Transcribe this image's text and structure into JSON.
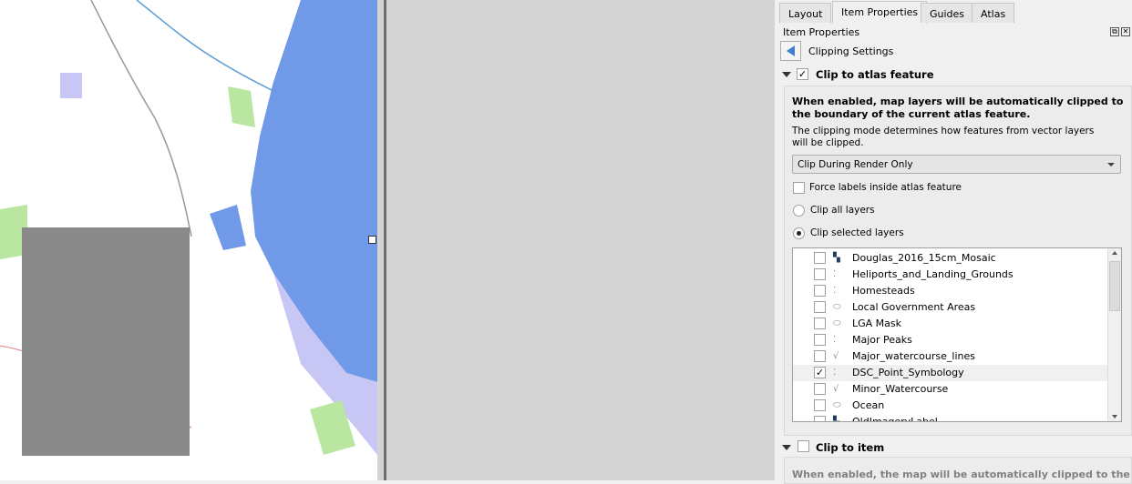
{
  "tabs": [
    {
      "label": "Layout"
    },
    {
      "label": "Item Properties"
    },
    {
      "label": "Guides"
    },
    {
      "label": "Atlas"
    }
  ],
  "panel_title": "Item Properties",
  "back_section": "Clipping Settings",
  "atlas_clip": {
    "label": "Clip to atlas feature",
    "checked": true,
    "desc_bold": "When enabled, map layers will be automatically clipped to the boundary of the current atlas feature.",
    "desc": "The clipping mode determines how features from vector layers will be clipped.",
    "mode_selected": "Clip During Render Only",
    "force_labels": {
      "label": "Force labels inside atlas feature",
      "checked": false
    },
    "clip_all": {
      "label": "Clip all layers",
      "selected": false
    },
    "clip_selected": {
      "label": "Clip selected layers",
      "selected": true
    },
    "layers": [
      {
        "name": "Douglas_2016_15cm_Mosaic",
        "icon": "raster-icon",
        "checked": false
      },
      {
        "name": "Heliports_and_Landing_Grounds",
        "icon": "point-layer-icon",
        "checked": false
      },
      {
        "name": "Homesteads",
        "icon": "point-layer-icon",
        "checked": false
      },
      {
        "name": "Local Government Areas",
        "icon": "polygon-layer-icon",
        "checked": false
      },
      {
        "name": "LGA Mask",
        "icon": "polygon-layer-icon",
        "checked": false
      },
      {
        "name": "Major Peaks",
        "icon": "point-layer-icon",
        "checked": false
      },
      {
        "name": "Major_watercourse_lines",
        "icon": "line-layer-icon",
        "checked": false
      },
      {
        "name": "DSC_Point_Symbology",
        "icon": "point-layer-icon",
        "checked": true
      },
      {
        "name": "Minor_Watercourse",
        "icon": "line-layer-icon",
        "checked": false
      },
      {
        "name": "Ocean",
        "icon": "polygon-layer-icon",
        "checked": false
      },
      {
        "name": "OldImageryLabel",
        "icon": "raster-icon",
        "checked": false
      }
    ]
  },
  "item_clip": {
    "label": "Clip to item",
    "checked": false,
    "desc_bold": "When enabled, the map will be automatically clipped to the"
  },
  "colors": {
    "ocean": "#7099e8",
    "park": "#b9e6a0",
    "overlay": "#8a8a8a",
    "lavender": "#c8c6f5"
  }
}
